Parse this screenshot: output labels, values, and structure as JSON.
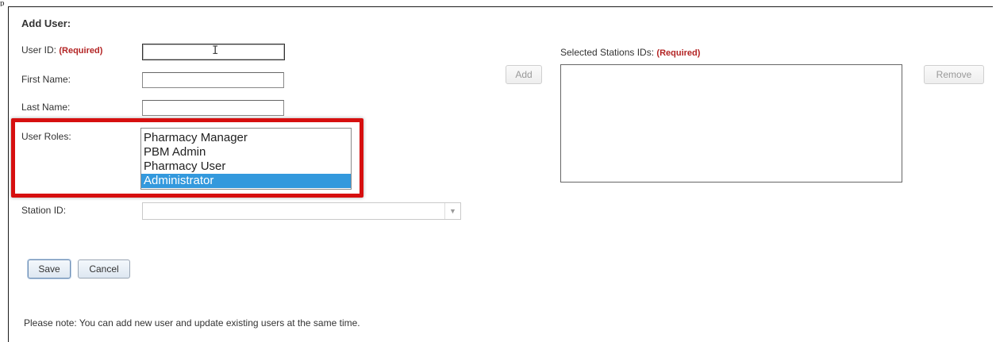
{
  "form": {
    "title": "Add User:",
    "required_marker": "(Required)",
    "user_id_label": "User ID:",
    "user_id_value": "",
    "first_name_label": "First Name:",
    "first_name_value": "",
    "last_name_label": "Last Name:",
    "last_name_value": "",
    "user_roles_label": "User Roles:",
    "user_roles_options": [
      "Pharmacy Manager",
      "PBM Admin",
      "Pharmacy User",
      "Administrator"
    ],
    "user_roles_selected": "Administrator",
    "station_id_label": "Station ID:",
    "station_id_value": ""
  },
  "stations": {
    "selected_label": "Selected Stations IDs:",
    "required_marker": "(Required)",
    "add_label": "Add",
    "remove_label": "Remove",
    "items": []
  },
  "actions": {
    "save_label": "Save",
    "cancel_label": "Cancel"
  },
  "note": "Please note: You can add new user and update existing users at the same time.",
  "colors": {
    "required": "#b32424",
    "highlight_border": "#d60f0f",
    "selected_option": "#3399dd"
  }
}
